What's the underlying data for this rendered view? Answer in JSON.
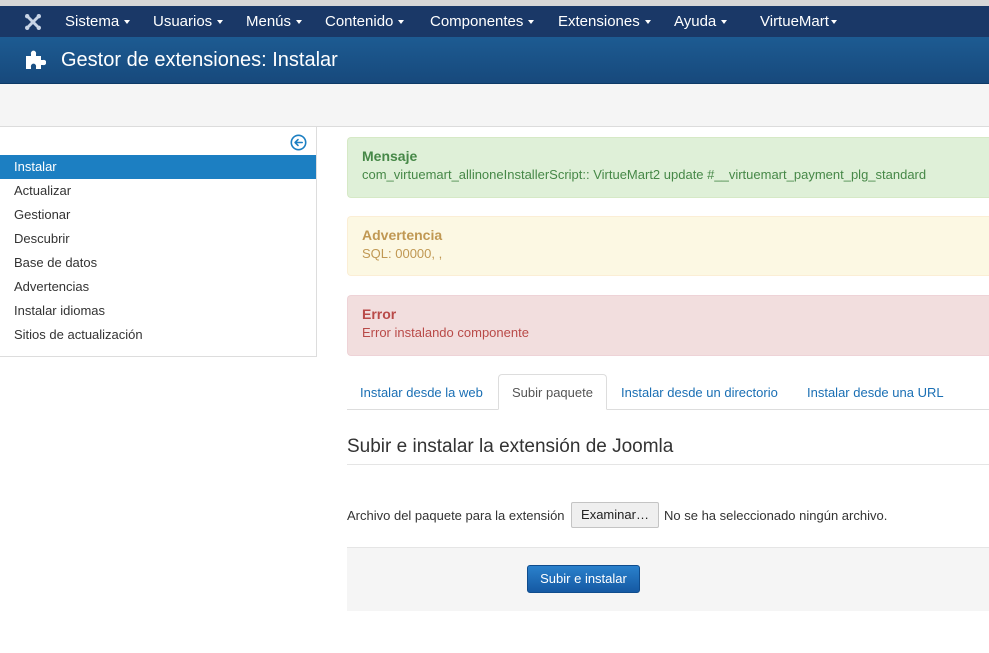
{
  "navbar": {
    "items": [
      {
        "label": "Sistema"
      },
      {
        "label": "Usuarios"
      },
      {
        "label": "Menús"
      },
      {
        "label": "Contenido"
      },
      {
        "label": "Componentes"
      },
      {
        "label": "Extensiones"
      },
      {
        "label": "Ayuda"
      },
      {
        "label": "VirtueMart"
      }
    ]
  },
  "header": {
    "title": "Gestor de extensiones: Instalar"
  },
  "sidebar": {
    "items": [
      {
        "label": "Instalar",
        "active": true
      },
      {
        "label": "Actualizar"
      },
      {
        "label": "Gestionar"
      },
      {
        "label": "Descubrir"
      },
      {
        "label": "Base de datos"
      },
      {
        "label": "Advertencias"
      },
      {
        "label": "Instalar idiomas"
      },
      {
        "label": "Sitios de actualización"
      }
    ]
  },
  "messages": {
    "message": {
      "heading": "Mensaje",
      "text": "com_virtuemart_allinoneInstallerScript:: VirtueMart2 update #__virtuemart_payment_plg_standard"
    },
    "warning": {
      "heading": "Advertencia",
      "text": "SQL: 00000, ,"
    },
    "error": {
      "heading": "Error",
      "text": "Error instalando componente"
    }
  },
  "tabs": [
    {
      "label": "Instalar desde la web"
    },
    {
      "label": "Subir paquete",
      "active": true
    },
    {
      "label": "Instalar desde un directorio"
    },
    {
      "label": "Instalar desde una URL"
    }
  ],
  "upload": {
    "title": "Subir e instalar la extensión de Joomla",
    "file_label": "Archivo del paquete para la extensión",
    "browse_label": "Examinar…",
    "file_status": "No se ha seleccionado ningún archivo.",
    "submit_label": "Subir e instalar"
  },
  "colors": {
    "navbar": "#1a3867",
    "titlebar": "#17568c",
    "active_item": "#1c7fc2",
    "link": "#1a6fb4"
  }
}
